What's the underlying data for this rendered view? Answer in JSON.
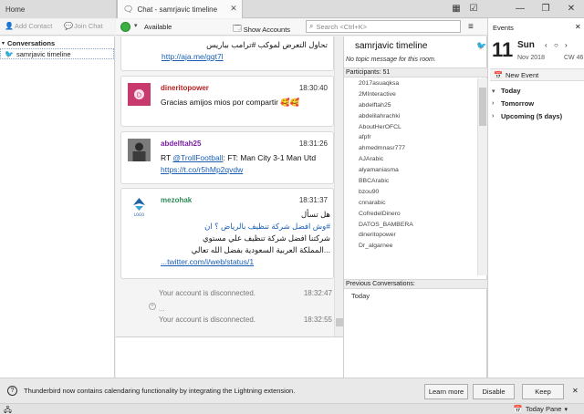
{
  "tabs": [
    {
      "label": "Home"
    },
    {
      "label": "Chat - samrjavic timeline"
    }
  ],
  "left_toolbar": {
    "add_contact": "Add Contact",
    "join_chat": "Join Chat"
  },
  "chat_toolbar": {
    "status": "Available",
    "show_accounts": "Show Accounts",
    "search_placeholder": "Search <Ctrl+K>"
  },
  "sidebar": {
    "header": "Conversations",
    "item": "samrjavic timeline"
  },
  "messages": [
    {
      "author": "",
      "time": "",
      "lines": [
        "تحاول التعرض لموكب #ترامب بباريس",
        "http://aja.me/gqt7l"
      ],
      "rtl": true
    },
    {
      "author": "dineritopower",
      "time": "18:30:40",
      "text": "Gracias amijos mios por compartir 🥰🥰"
    },
    {
      "author": "abdelftah25",
      "time": "18:31:26",
      "text_prefix": "RT ",
      "mention": "@TrollFootball",
      "text_mid": ": FT: Man City 3-1 Man Utd ",
      "link": "https://t.co/r5hMp2qvdw"
    },
    {
      "author": "mezohak",
      "time": "18:31:37",
      "lines": [
        "هل تسأل",
        "#وش افضل شركة تنظيف بالرياض ؟ ان",
        "شركتنا افضل شركة تنظيف علي مستوي",
        "...المملكة العربية السعودية بفضل الله تعالي"
      ],
      "link": "twitter.com/i/web/status/1..."
    }
  ],
  "system_messages": [
    {
      "text": "Your account is disconnected.",
      "time": "18:32:47"
    },
    {
      "text": "Your account is disconnected.",
      "time": "18:32:55"
    }
  ],
  "room": {
    "title": "samrjavic timeline",
    "topic": "No topic message for this room.",
    "participants_label": "Participants: 51",
    "participants": [
      "2017asuaqksa",
      "2MInteractive",
      "abdelftah25",
      "abdelilahrachki",
      "AboutHerOFCL",
      "afpfr",
      "ahmedmnasr777",
      "AJArabic",
      "alyamaniasma",
      "BBCArabic",
      "bzou90",
      "cnnarabic",
      "CofredelDinero",
      "DATOS_BAMBERA",
      "dineritopower",
      "Dr_algarnee"
    ],
    "previous_conversations_label": "Previous Conversations:",
    "previous_today": "Today"
  },
  "events": {
    "title": "Events",
    "day": "11",
    "dow": "Sun",
    "month_year": "Nov 2018",
    "week": "CW 46",
    "new_event": "New Event",
    "groups": [
      "Today",
      "Tomorrow",
      "Upcoming (5 days)"
    ]
  },
  "notification": {
    "text": "Thunderbird now contains calendaring functionality by integrating the Lightning extension.",
    "learn_more": "Learn more",
    "disable": "Disable",
    "keep": "Keep"
  },
  "statusbar": {
    "today_pane": "Today Pane"
  },
  "colors": {
    "accent_link": "#1a5fb4",
    "author_red": "#b22222",
    "author_purple": "#7a1fa2",
    "author_green": "#2e8b57",
    "online_green": "#3cb043"
  }
}
